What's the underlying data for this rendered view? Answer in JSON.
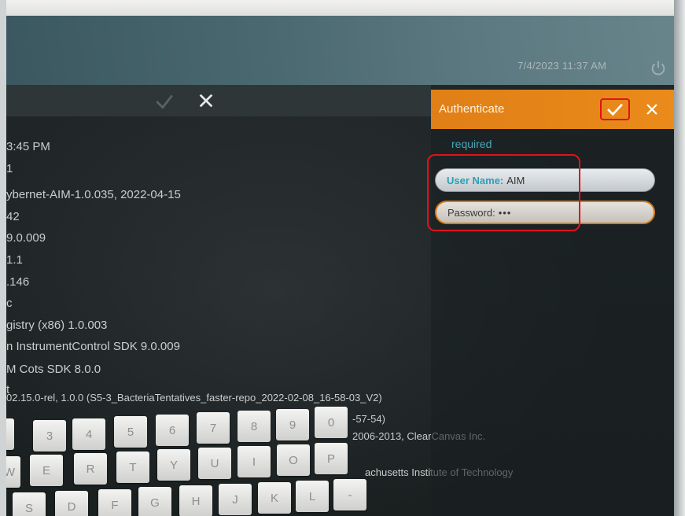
{
  "status_bar": {
    "datetime": "7/4/2023 11:37 AM",
    "power_icon": "power-icon"
  },
  "left_panel": {
    "lines": [
      "3:45 PM",
      "1",
      "ybernet-AIM-1.0.035, 2022-04-15",
      "42",
      "9.0.009",
      " 1.1",
      ".146",
      "c",
      "gistry (x86) 1.0.003",
      "n InstrumentControl SDK 9.0.009",
      "M Cots SDK 8.0.0",
      "t",
      "02.15.0-rel, 1.0.0 (S5-3_BacteriaTentatives_faster-repo_2022-02-08_16-58-03_V2)",
      "-57-54)",
      "2006-2013, ClearCanvas Inc.",
      "achusetts Institute of Technology"
    ]
  },
  "auth": {
    "title": "Authenticate",
    "required_text": "required",
    "username_label": "User Name:",
    "username_value": "AIM",
    "password_label": "Password:",
    "password_value": "•••",
    "accent": "#e98a1b",
    "highlight_color": "#e0121b"
  },
  "keyboard": {
    "row1": [
      "3",
      "4",
      "5",
      "6",
      "7",
      "8",
      "9",
      "0"
    ],
    "row2": [
      "W",
      "E",
      "R",
      "T",
      "Y",
      "U",
      "I",
      "O",
      "P"
    ],
    "row3": [
      "S",
      "D",
      "F",
      "G",
      "H",
      "J",
      "K",
      "L",
      "-"
    ]
  }
}
